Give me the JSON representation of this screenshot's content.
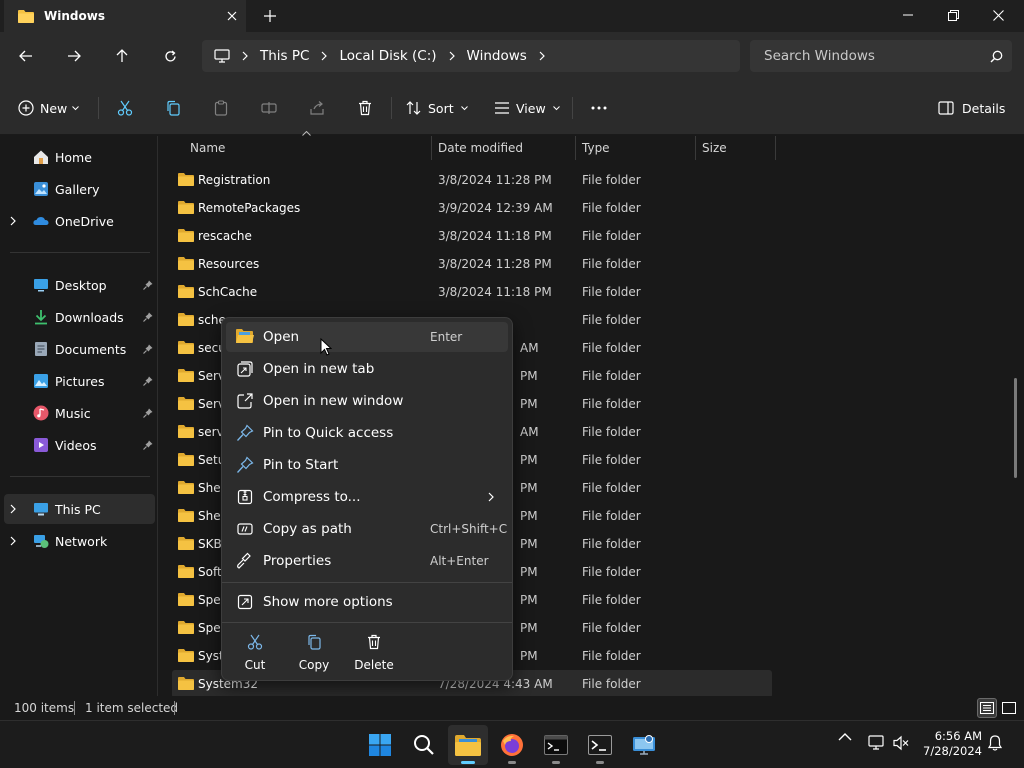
{
  "window": {
    "tab_title": "Windows"
  },
  "address": {
    "crumbs": [
      "This PC",
      "Local Disk (C:)",
      "Windows"
    ]
  },
  "search": {
    "placeholder": "Search Windows"
  },
  "toolbar": {
    "new_label": "New",
    "sort_label": "Sort",
    "view_label": "View",
    "details_label": "Details"
  },
  "sidebar": {
    "items": [
      {
        "label": "Home",
        "icon": "home-icon"
      },
      {
        "label": "Gallery",
        "icon": "gallery-icon"
      },
      {
        "label": "OneDrive",
        "icon": "onedrive-icon"
      },
      {
        "label": "Desktop",
        "icon": "desktop-icon"
      },
      {
        "label": "Downloads",
        "icon": "downloads-icon"
      },
      {
        "label": "Documents",
        "icon": "documents-icon"
      },
      {
        "label": "Pictures",
        "icon": "pictures-icon"
      },
      {
        "label": "Music",
        "icon": "music-icon"
      },
      {
        "label": "Videos",
        "icon": "videos-icon"
      },
      {
        "label": "This PC",
        "icon": "pc-icon"
      },
      {
        "label": "Network",
        "icon": "network-icon"
      }
    ]
  },
  "columns": {
    "name": "Name",
    "date": "Date modified",
    "type": "Type",
    "size": "Size"
  },
  "files": [
    {
      "name": "Registration",
      "date": "3/8/2024 11:28 PM",
      "type": "File folder"
    },
    {
      "name": "RemotePackages",
      "date": "3/9/2024 12:39 AM",
      "type": "File folder"
    },
    {
      "name": "rescache",
      "date": "3/8/2024 11:18 PM",
      "type": "File folder"
    },
    {
      "name": "Resources",
      "date": "3/8/2024 11:28 PM",
      "type": "File folder"
    },
    {
      "name": "SchCache",
      "date": "3/8/2024 11:18 PM",
      "type": "File folder"
    },
    {
      "name": "sche",
      "date": "",
      "type": "File folder"
    },
    {
      "name": "secu",
      "date": "AM",
      "type": "File folder"
    },
    {
      "name": "Serv",
      "date": "PM",
      "type": "File folder"
    },
    {
      "name": "Serv",
      "date": "PM",
      "type": "File folder"
    },
    {
      "name": "serv",
      "date": "AM",
      "type": "File folder"
    },
    {
      "name": "Setu",
      "date": "PM",
      "type": "File folder"
    },
    {
      "name": "Shel",
      "date": "PM",
      "type": "File folder"
    },
    {
      "name": "Shel",
      "date": "PM",
      "type": "File folder"
    },
    {
      "name": "SKB",
      "date": "PM",
      "type": "File folder"
    },
    {
      "name": "Soft",
      "date": "PM",
      "type": "File folder"
    },
    {
      "name": "Spee",
      "date": "PM",
      "type": "File folder"
    },
    {
      "name": "Spee",
      "date": "PM",
      "type": "File folder"
    },
    {
      "name": "Syst",
      "date": "PM",
      "type": "File folder"
    },
    {
      "name": "System32",
      "date": "7/28/2024 4:43 AM",
      "type": "File folder"
    }
  ],
  "context_menu": {
    "items": [
      {
        "label": "Open",
        "shortcut": "Enter",
        "icon": "folder-open-icon"
      },
      {
        "label": "Open in new tab",
        "shortcut": "",
        "icon": "new-tab-icon"
      },
      {
        "label": "Open in new window",
        "shortcut": "",
        "icon": "new-window-icon"
      },
      {
        "label": "Pin to Quick access",
        "shortcut": "",
        "icon": "pin-icon"
      },
      {
        "label": "Pin to Start",
        "shortcut": "",
        "icon": "pin-start-icon"
      },
      {
        "label": "Compress to...",
        "shortcut": "",
        "icon": "compress-icon"
      },
      {
        "label": "Copy as path",
        "shortcut": "Ctrl+Shift+C",
        "icon": "copy-path-icon"
      },
      {
        "label": "Properties",
        "shortcut": "Alt+Enter",
        "icon": "properties-icon"
      },
      {
        "label": "Show more options",
        "shortcut": "",
        "icon": "more-options-icon"
      }
    ],
    "quick_actions": [
      {
        "label": "Cut",
        "icon": "cut-icon"
      },
      {
        "label": "Copy",
        "icon": "copy-icon"
      },
      {
        "label": "Delete",
        "icon": "delete-icon"
      }
    ]
  },
  "status": {
    "count": "100 items",
    "selected": "1 item selected"
  },
  "taskbar": {
    "time": "6:56 AM",
    "date": "7/28/2024"
  },
  "colors": {
    "accent": "#60cdff",
    "folder": "#f5c242",
    "background": "#191919"
  }
}
